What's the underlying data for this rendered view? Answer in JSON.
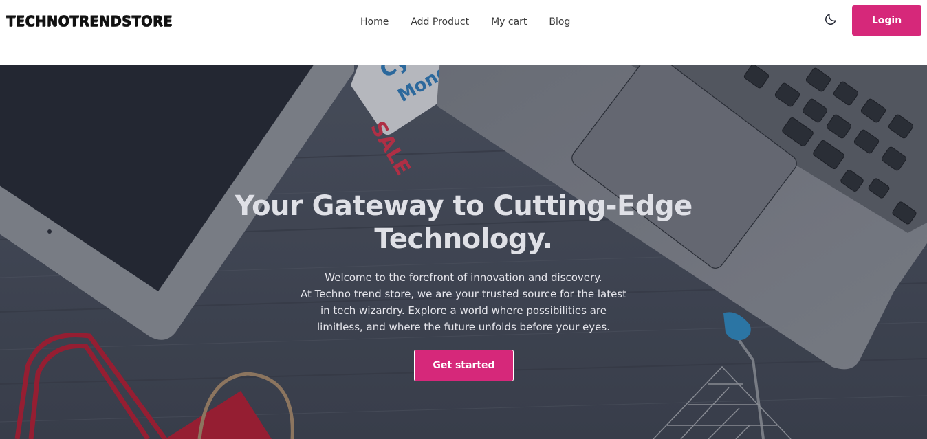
{
  "brand": {
    "logo_text": "TECHNOTRENDSTORE",
    "accent_color": "#d6287a"
  },
  "nav": {
    "links": [
      {
        "label": "Home"
      },
      {
        "label": "Add Product"
      },
      {
        "label": "My cart"
      },
      {
        "label": "Blog"
      }
    ],
    "theme_icon": "moon-icon",
    "login_label": "Login"
  },
  "hero": {
    "title": "Your Gateway to Cutting-Edge Technology.",
    "description_lines": [
      "Welcome to the forefront of innovation and discovery.",
      "At Techno trend store, we are your trusted source for the latest",
      "in tech wizardry. Explore a world where possibilities are",
      "limitless, and where the future unfolds before your eyes."
    ],
    "cta_label": "Get started",
    "background_sale_text": "SALE",
    "background_tag_text": "Cyber Monday"
  }
}
